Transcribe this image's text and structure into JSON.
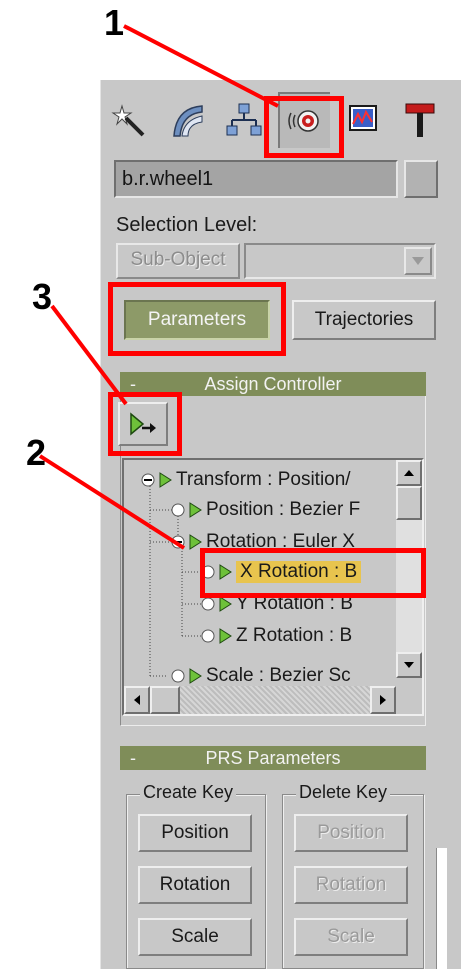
{
  "object_name": "b.r.wheel1",
  "selection_level_label": "Selection Level:",
  "sub_object_label": "Sub-Object",
  "tabs": [
    {
      "name": "create-tab",
      "icon": "wand-icon"
    },
    {
      "name": "modify-tab",
      "icon": "modify-arc-icon"
    },
    {
      "name": "hierarchy-tab",
      "icon": "hierarchy-icon"
    },
    {
      "name": "motion-tab",
      "icon": "motion-icon"
    },
    {
      "name": "display-tab",
      "icon": "display-icon"
    },
    {
      "name": "utilities-tab",
      "icon": "hammer-icon"
    }
  ],
  "mode_buttons": {
    "parameters": "Parameters",
    "trajectories": "Trajectories"
  },
  "assign_controller": {
    "title": "Assign Controller",
    "collapse": "-",
    "tree": [
      {
        "label": "Transform : Position/",
        "level": 0
      },
      {
        "label": "Position : Bezier F",
        "level": 1
      },
      {
        "label": "Rotation : Euler X",
        "level": 1
      },
      {
        "label": "X Rotation : B",
        "level": 2,
        "selected": true
      },
      {
        "label": "Y Rotation : B",
        "level": 2
      },
      {
        "label": "Z Rotation : B",
        "level": 2
      },
      {
        "label": "Scale : Bezier Sc",
        "level": 1
      }
    ]
  },
  "prs": {
    "title": "PRS Parameters",
    "collapse": "-",
    "create_key": {
      "title": "Create Key",
      "buttons": [
        "Position",
        "Rotation",
        "Scale"
      ]
    },
    "delete_key": {
      "title": "Delete Key",
      "buttons": [
        "Position",
        "Rotation",
        "Scale"
      ]
    }
  },
  "annotations": [
    "1",
    "2",
    "3"
  ],
  "colors": {
    "highlight": "#ff0000",
    "rollout": "#7f8d59",
    "selected": "#e8c44e"
  }
}
